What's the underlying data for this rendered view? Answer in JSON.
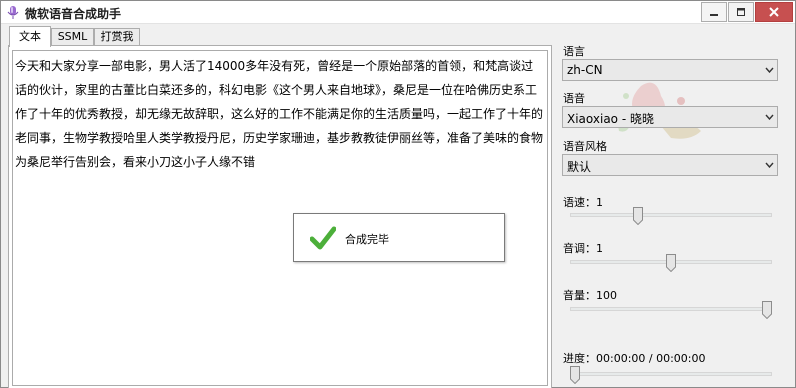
{
  "window": {
    "title": "微软语音合成助手"
  },
  "tabs": [
    {
      "label": "文本",
      "active": true
    },
    {
      "label": "SSML",
      "active": false
    },
    {
      "label": "打赏我",
      "active": false
    }
  ],
  "text_content": "今天和大家分享一部电影，男人活了14000多年没有死，曾经是一个原始部落的首领，和梵高谈过话的伙计，家里的古董比白菜还多的，科幻电影《这个男人来自地球》，桑尼是一位在哈佛历史系工作了十年的优秀教授，却无缘无故辞职，这么好的工作不能满足你的生活质量吗，一起工作了十年的老同事，生物学教授哈里人类学教授丹尼，历史学家珊迪，基步教教徒伊丽丝等，准备了美味的食物为桑尼举行告别会，看来小刀这小子人缘不错",
  "toast": {
    "message": "合成完毕"
  },
  "settings": {
    "language": {
      "label": "语言",
      "value": "zh-CN"
    },
    "voice": {
      "label": "语音",
      "value": "Xiaoxiao - 晓晓"
    },
    "style": {
      "label": "语音风格",
      "value": "默认"
    },
    "rate": {
      "label": "语速：",
      "value": "1",
      "level": 0.33
    },
    "pitch": {
      "label": "音调：",
      "value": "1",
      "level": 0.5
    },
    "volume": {
      "label": "音量：",
      "value": "100",
      "level": 1.0
    },
    "progress": {
      "label": "进度：",
      "value": "00:00:00 / 00:00:00",
      "level": 0.0
    }
  },
  "colors": {
    "check_green": "#4caf3a",
    "close_red": "#c75050"
  }
}
